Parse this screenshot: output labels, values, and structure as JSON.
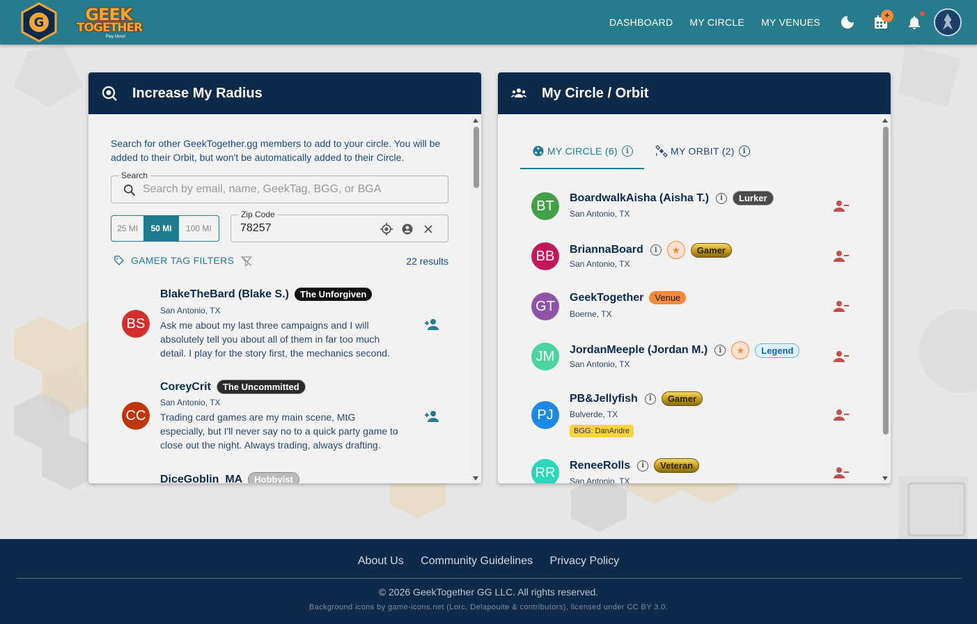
{
  "brand": {
    "logo_mark": "G",
    "word_line1": "GEEK",
    "word_line2": "TOGETHER",
    "tagline": "Play More!"
  },
  "nav": {
    "dashboard": "DASHBOARD",
    "my_circle": "MY CIRCLE",
    "my_venues": "MY VENUES",
    "calendar_badge": "+"
  },
  "radius_card": {
    "title": "Increase My Radius",
    "intro": "Search for other GeekTogether.gg members to add to your circle. You will be added to their Orbit, but won't be automatically added to their Circle.",
    "search_label": "Search",
    "search_placeholder": "Search by email, name, GeekTag, BGG, or BGA",
    "radius_options": [
      "25 MI",
      "50 MI",
      "100 MI"
    ],
    "radius_selected": "50 MI",
    "zip_label": "Zip Code",
    "zip_value": "78257",
    "tag_filters": "GAMER TAG FILTERS",
    "results": "22 results",
    "members": [
      {
        "initials": "BS",
        "name": "BlakeTheBard (Blake S.)",
        "tag": "The Unforgiven",
        "location": "San Antonio, TX",
        "bio": "Ask me about my last three campaigns and I will absolutely tell you about all of them in far too much detail. I play for the story first, the mechanics second.",
        "color": "#d32f2f"
      },
      {
        "initials": "CC",
        "name": "CoreyCrit",
        "tag": "The Uncommitted",
        "location": "San Antonio, TX",
        "bio": "Trading card games are my main scene, MtG especially, but I'll never say no to a quick party game to close out the night. Always trading, always drafting.",
        "color": "#bf360c"
      },
      {
        "initials": "",
        "name": "DiceGoblin_MA",
        "tag": "Hobbyist",
        "location": "",
        "bio": "",
        "color": "#888888"
      }
    ]
  },
  "circle_card": {
    "title": "My Circle / Orbit",
    "tab_circle": "MY CIRCLE (6)",
    "tab_orbit": "MY ORBIT (2)",
    "members": [
      {
        "initials": "BT",
        "name": "BoardwalkAisha (Aisha T.)",
        "location": "San Antonio, TX",
        "tag": "Lurker",
        "color": "#43a047"
      },
      {
        "initials": "BB",
        "name": "BriannaBoard",
        "location": "San Antonio, TX",
        "tag": "Gamer",
        "color": "#c2185b"
      },
      {
        "initials": "GT",
        "name": "GeekTogether",
        "location": "Boerne, TX",
        "tag": "Venue",
        "color": "#8e54a8"
      },
      {
        "initials": "JM",
        "name": "JordanMeeple (Jordan M.)",
        "location": "San Antonio, TX",
        "tag": "Legend",
        "color": "#4cd3a0"
      },
      {
        "initials": "PJ",
        "name": "PB&Jellyfish",
        "location": "Bulverde, TX",
        "tag": "Gamer",
        "bgg": "BGG: DanAndre",
        "color": "#1e88e5"
      },
      {
        "initials": "RR",
        "name": "ReneeRolls",
        "location": "San Antonio, TX",
        "tag": "Veteran",
        "color": "#2ad7b8"
      }
    ]
  },
  "footer": {
    "about": "About Us",
    "guidelines": "Community Guidelines",
    "privacy": "Privacy Policy",
    "copyright": "© 2026 GeekTogether GG LLC. All rights reserved.",
    "credits": "Background icons by game-icons.net (Lorc, Delapouite & contributors), licensed under CC BY 3.0."
  },
  "colors": {
    "header_bg": "#267b8c",
    "card_header_bg": "#0e2a4a",
    "accent": "#1f7b8f",
    "remove_icon": "#c0504d"
  }
}
